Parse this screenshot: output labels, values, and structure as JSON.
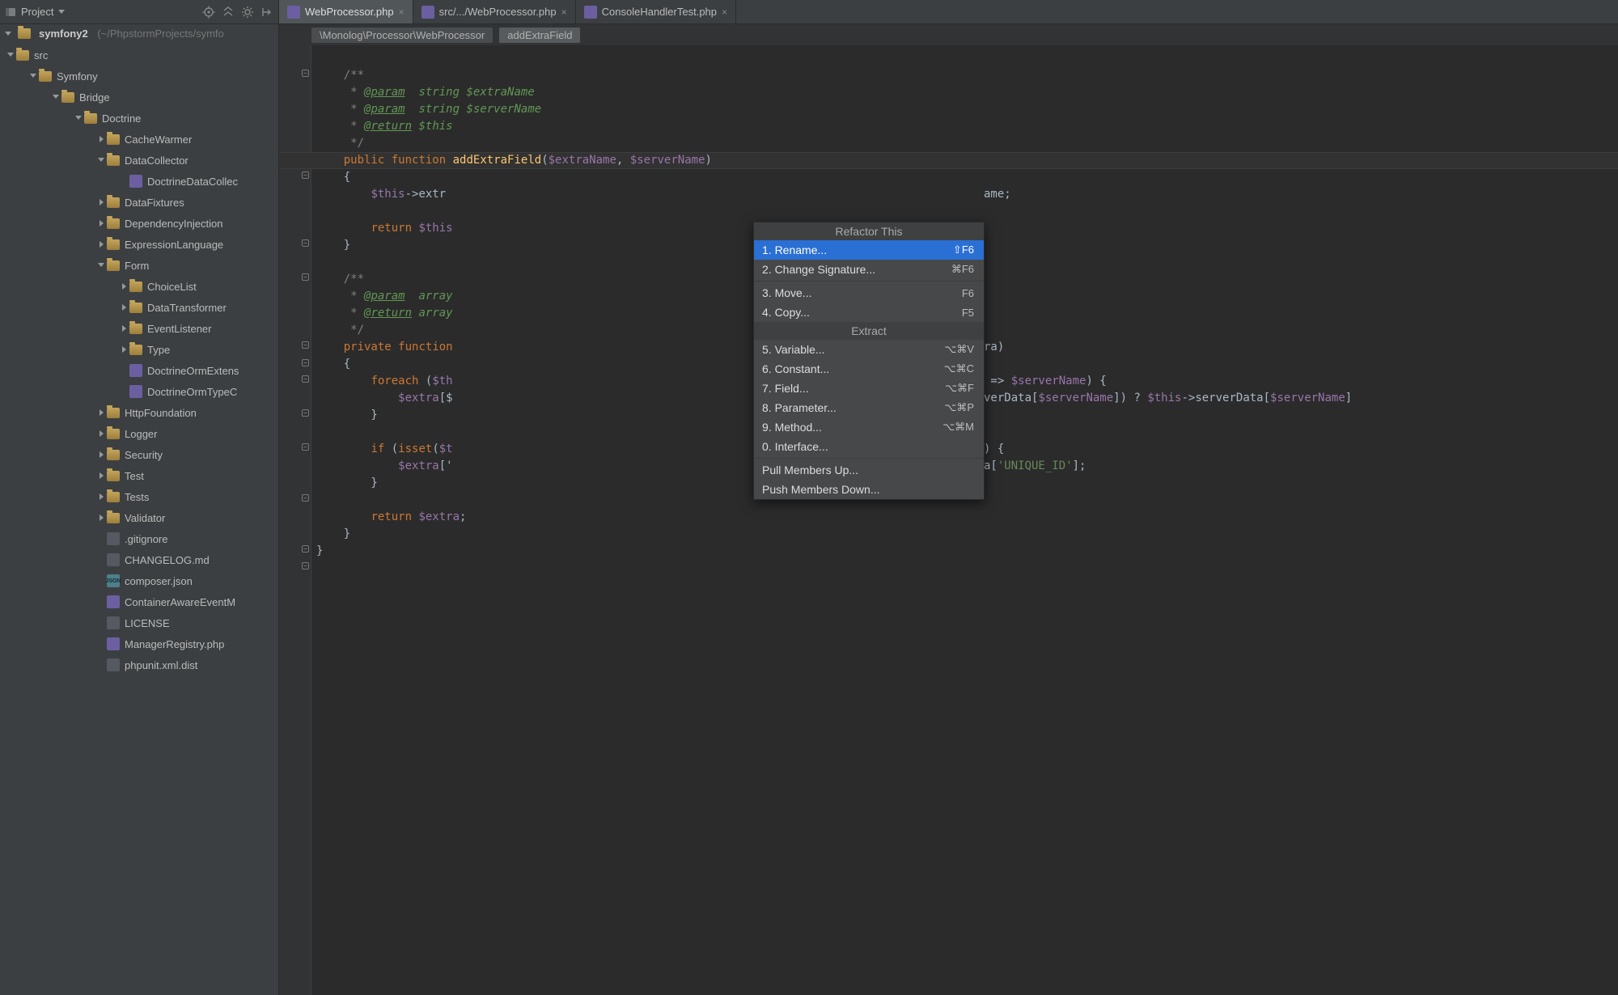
{
  "sidebar": {
    "project_selector": "Project",
    "root_name": "symfony2",
    "root_path": "(~/PhpstormProjects/symfo"
  },
  "tree": [
    {
      "depth": 0,
      "exp": "down",
      "icon": "folder",
      "label": "src"
    },
    {
      "depth": 1,
      "exp": "down",
      "icon": "folder",
      "label": "Symfony"
    },
    {
      "depth": 2,
      "exp": "down",
      "icon": "folder",
      "label": "Bridge"
    },
    {
      "depth": 3,
      "exp": "down",
      "icon": "folder",
      "label": "Doctrine"
    },
    {
      "depth": 4,
      "exp": "right",
      "icon": "folder",
      "label": "CacheWarmer"
    },
    {
      "depth": 4,
      "exp": "down",
      "icon": "folder",
      "label": "DataCollector"
    },
    {
      "depth": 5,
      "exp": "",
      "icon": "php",
      "label": "DoctrineDataCollec"
    },
    {
      "depth": 4,
      "exp": "right",
      "icon": "folder",
      "label": "DataFixtures"
    },
    {
      "depth": 4,
      "exp": "right",
      "icon": "folder",
      "label": "DependencyInjection"
    },
    {
      "depth": 4,
      "exp": "right",
      "icon": "folder",
      "label": "ExpressionLanguage"
    },
    {
      "depth": 4,
      "exp": "down",
      "icon": "folder",
      "label": "Form"
    },
    {
      "depth": 5,
      "exp": "right",
      "icon": "folder",
      "label": "ChoiceList"
    },
    {
      "depth": 5,
      "exp": "right",
      "icon": "folder",
      "label": "DataTransformer"
    },
    {
      "depth": 5,
      "exp": "right",
      "icon": "folder",
      "label": "EventListener"
    },
    {
      "depth": 5,
      "exp": "right",
      "icon": "folder",
      "label": "Type"
    },
    {
      "depth": 5,
      "exp": "",
      "icon": "php",
      "label": "DoctrineOrmExtens"
    },
    {
      "depth": 5,
      "exp": "",
      "icon": "php",
      "label": "DoctrineOrmTypeC"
    },
    {
      "depth": 4,
      "exp": "right",
      "icon": "folder",
      "label": "HttpFoundation"
    },
    {
      "depth": 4,
      "exp": "right",
      "icon": "folder",
      "label": "Logger"
    },
    {
      "depth": 4,
      "exp": "right",
      "icon": "folder",
      "label": "Security"
    },
    {
      "depth": 4,
      "exp": "right",
      "icon": "folder",
      "label": "Test"
    },
    {
      "depth": 4,
      "exp": "right",
      "icon": "folder",
      "label": "Tests"
    },
    {
      "depth": 4,
      "exp": "right",
      "icon": "folder",
      "label": "Validator"
    },
    {
      "depth": 4,
      "exp": "",
      "icon": "file",
      "label": ".gitignore"
    },
    {
      "depth": 4,
      "exp": "",
      "icon": "file",
      "label": "CHANGELOG.md"
    },
    {
      "depth": 4,
      "exp": "",
      "icon": "json",
      "label": "composer.json"
    },
    {
      "depth": 4,
      "exp": "",
      "icon": "php",
      "label": "ContainerAwareEventM"
    },
    {
      "depth": 4,
      "exp": "",
      "icon": "file",
      "label": "LICENSE"
    },
    {
      "depth": 4,
      "exp": "",
      "icon": "php",
      "label": "ManagerRegistry.php"
    },
    {
      "depth": 4,
      "exp": "",
      "icon": "file",
      "label": "phpunit.xml.dist"
    }
  ],
  "tabs": [
    {
      "label": "WebProcessor.php",
      "icon": "php",
      "active": true
    },
    {
      "label": "src/.../WebProcessor.php",
      "icon": "php",
      "active": false
    },
    {
      "label": "ConsoleHandlerTest.php",
      "icon": "php",
      "active": false
    }
  ],
  "breadcrumb": {
    "path": "\\Monolog\\Processor\\WebProcessor",
    "symbol": "addExtraField"
  },
  "code_left_of_popup": [
    "",
    "    /**",
    "     * @param  string $extraName",
    "     * @param  string $serverName",
    "     * @return $this",
    "     */",
    "    public function addExtraField($extraName, $serverName)",
    "    {",
    "        $this->extr",
    "",
    "        return $this",
    "    }",
    "",
    "    /**",
    "     * @param  array",
    "     * @return array",
    "     */",
    "    private function",
    "    {",
    "        foreach ($th",
    "            $extra[$",
    "        }",
    "",
    "        if (isset($t",
    "            $extra['",
    "        }",
    "",
    "        return $extra;",
    "    }",
    "}"
  ],
  "code_right_fragments": {
    "l8_name": "ame;",
    "l17_ra_close": "ra)",
    "l19_after": " => $serverName) {",
    "l20_after": "verData[$serverName]) ? $this->serverData[$serverName]",
    "l23_after": ") {",
    "l24_after": "a['UNIQUE_ID'];"
  },
  "popup": {
    "title": "Refactor This",
    "items_a": [
      {
        "n": "1",
        "label": "Rename...",
        "shortcut": "⇧F6",
        "selected": true
      },
      {
        "n": "2",
        "label": "Change Signature...",
        "shortcut": "⌘F6"
      }
    ],
    "items_b": [
      {
        "n": "3",
        "label": "Move...",
        "shortcut": "F6"
      },
      {
        "n": "4",
        "label": "Copy...",
        "shortcut": "F5"
      }
    ],
    "section": "Extract",
    "items_c": [
      {
        "n": "5",
        "label": "Variable...",
        "shortcut": "⌥⌘V"
      },
      {
        "n": "6",
        "label": "Constant...",
        "shortcut": "⌥⌘C"
      },
      {
        "n": "7",
        "label": "Field...",
        "shortcut": "⌥⌘F"
      },
      {
        "n": "8",
        "label": "Parameter...",
        "shortcut": "⌥⌘P"
      },
      {
        "n": "9",
        "label": "Method...",
        "shortcut": "⌥⌘M"
      },
      {
        "n": "0",
        "label": "Interface..."
      }
    ],
    "items_d": [
      {
        "label": "Pull Members Up..."
      },
      {
        "label": "Push Members Down..."
      }
    ]
  }
}
